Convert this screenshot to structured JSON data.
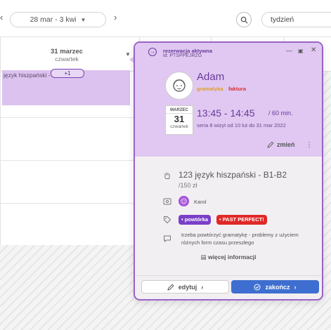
{
  "toolbar": {
    "date_range": "28 mar - 3 kwi",
    "prev_icon": "chevron-left-icon",
    "next_icon": "chevron-right-icon",
    "view_mode": "tydzień"
  },
  "calendar": {
    "column_date": "31 marzec",
    "column_weekday": "czwartek",
    "event_label": "język hiszpański - B",
    "more_events": "+1"
  },
  "popup": {
    "status": "rezerwacja aktywna",
    "id": "id: PTSPPEJRZG",
    "client_name": "Adam",
    "tags": [
      {
        "label": "gramatyka",
        "color": "#e0a020"
      },
      {
        "label": "faktura",
        "color": "#d93030"
      }
    ],
    "date": {
      "month": "MARZEC",
      "day": "31",
      "weekday": "czwartek"
    },
    "time_range": "13:45 - 14:45",
    "duration": "/ 60 min.",
    "series": "seria 8 wizyt od 10 lut do 31 mar 2022",
    "change_label": "zmień",
    "service": {
      "name": "123 język hiszpański - B1-B2",
      "price": "/150 zł"
    },
    "teacher": "Karol",
    "badges": [
      {
        "label": "• powtórka",
        "color": "#7a3fc8"
      },
      {
        "label": "• PAST PERFECT!",
        "color": "#e02828"
      }
    ],
    "note": "trzeba powtórzyć gramatykę - problemy z użyciem różnych form czasu przeszłego",
    "more_info": "więcej informacji",
    "edit_label": "edytuj",
    "finish_label": "zakończ"
  }
}
